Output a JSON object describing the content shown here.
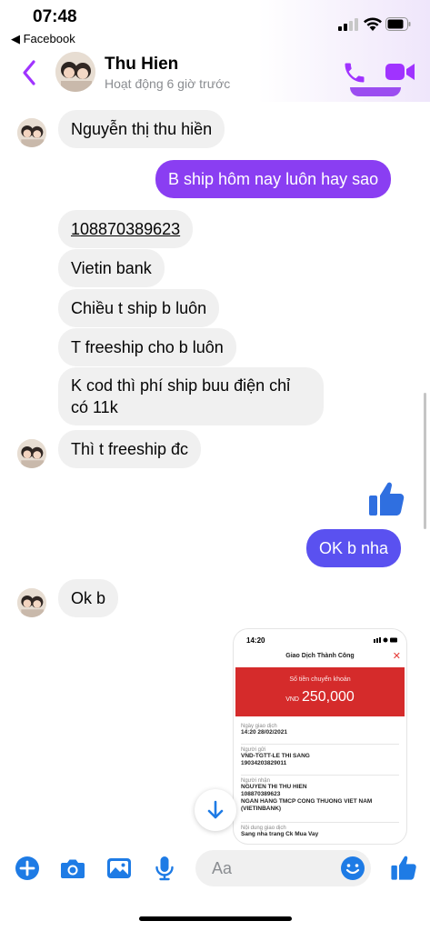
{
  "status_bar": {
    "time": "07:48",
    "back_app": "◀ Facebook"
  },
  "header": {
    "contact_name": "Thu Hien",
    "status": "Hoạt động 6 giờ trước"
  },
  "colors": {
    "accent": "#a033ff",
    "accent_alt": "#7b3ff2",
    "bubble_incoming": "#f0f0f0",
    "bubble_outgoing_a": "#9b38f5",
    "bubble_outgoing_b": "#5b4ff0",
    "like_blue": "#1e7be5"
  },
  "messages": [
    {
      "sender": "them",
      "text": "Nguyễn thị thu hiền"
    },
    {
      "sender": "me",
      "text": "B ship hôm nay luôn hay sao"
    },
    {
      "sender": "them",
      "text": "108870389623"
    },
    {
      "sender": "them",
      "text": "Vietin bank"
    },
    {
      "sender": "them",
      "text": "Chiều t ship b luôn"
    },
    {
      "sender": "them",
      "text": "T freeship cho b luôn"
    },
    {
      "sender": "them",
      "text_line1": "K cod thì phí ship buu điện chỉ",
      "text_line2": "có 11k"
    },
    {
      "sender": "them",
      "text": "Thì t freeship đc"
    },
    {
      "sender": "me",
      "type": "like",
      "icon": "thumbs-up-icon"
    },
    {
      "sender": "me",
      "text": "OK b nha"
    },
    {
      "sender": "them",
      "text": "Ok b"
    }
  ],
  "transfer_screenshot": {
    "time": "14:20",
    "title": "Giao Dịch Thành Công",
    "amount_label": "Số tiền chuyển khoản",
    "currency": "VND",
    "amount": "250,000",
    "date_label": "Ngày giao dịch",
    "date": "14:20 28/02/2021",
    "sender_label": "Người gửi",
    "sender_name": "VND-TGTT-LE THI SANG",
    "sender_account": "19034203829011",
    "receiver_label": "Người nhận",
    "receiver_name": "NGUYEN THI THU HIEN",
    "receiver_account": "108870389623",
    "receiver_bank_1": "NGAN HANG TMCP CONG THUONG VIET NAM",
    "receiver_bank_2": "(VIETINBANK)",
    "content_label": "Nội dung giao dịch",
    "content": "Sang nha trang Ck Mua Vay"
  },
  "composer": {
    "placeholder": "Aa"
  }
}
